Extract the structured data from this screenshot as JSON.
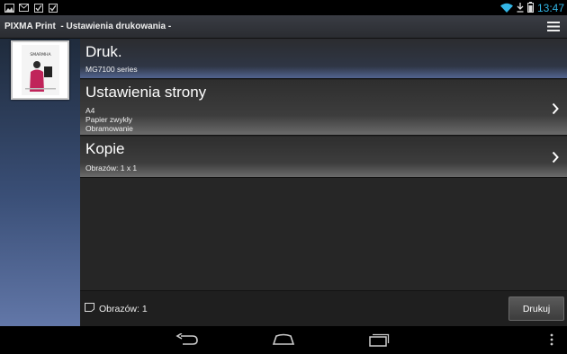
{
  "status_bar": {
    "time": "13:47",
    "left_icons": [
      "gallery-icon",
      "gmail-icon",
      "checkbox-icon",
      "checkbox-icon"
    ],
    "right_icons": [
      "wifi-icon",
      "download-icon",
      "battery-icon"
    ]
  },
  "action_bar": {
    "title": "PIXMA Print  - Ustawienia drukowania -",
    "menu_icon": "hamburger-menu-icon"
  },
  "preview": {
    "thumbnail_text": "SMARMHA"
  },
  "printer_row": {
    "title": "Druk.",
    "subtitle": "MG7100 series"
  },
  "page_settings_row": {
    "title": "Ustawienia strony",
    "lines": [
      "A4",
      "Papier zwykły",
      "Obramowanie"
    ]
  },
  "copies_row": {
    "title": "Kopie",
    "subtitle": "Obrazów: 1 x 1"
  },
  "bottom_bar": {
    "image_count": "Obrazów: 1",
    "print_button": "Drukuj"
  },
  "colors": {
    "accent": "#33b5e5",
    "printer_row_highlight": "#52648f"
  },
  "nav_bar": {
    "buttons": [
      "back-icon",
      "home-icon",
      "recents-icon",
      "overflow-icon"
    ]
  }
}
